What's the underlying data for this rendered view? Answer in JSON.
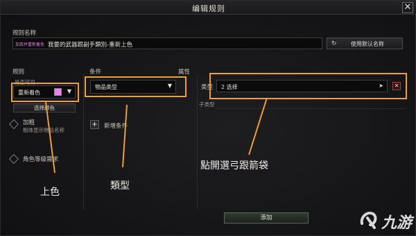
{
  "dialog": {
    "title": "编辑规则",
    "close_glyph": "✕"
  },
  "rule_name": {
    "label": "规则名称",
    "tag": "加我并重新着色",
    "value": "我要的武器跟副手類別-重新上色",
    "default_button_icon": "refresh-icon",
    "default_button_label": "使用默认名称"
  },
  "columns": {
    "rules_header": "规则",
    "conditions_header": "条件",
    "attributes_header": "属性"
  },
  "rules_panel": {
    "visible_label": "是否可见",
    "recolor_value": "重新着色",
    "swatch_color": "#f07ef0",
    "select_color_button": "选择颜色",
    "option1_label": "加粗",
    "option1_desc": "粗体显示物品名称",
    "option2_label": "角色等级需求"
  },
  "conditions_panel": {
    "item_type_value": "物品类型",
    "add_condition_label": "新增条件"
  },
  "attributes_panel": {
    "type_label": "类型",
    "type_value": "2 选择",
    "subtype_label": "子类型"
  },
  "annotations": {
    "color": "上色",
    "type": "類型",
    "bow": "點開選弓跟箭袋"
  },
  "footer": {
    "add_button": "添加"
  },
  "watermark": {
    "text": "九游"
  },
  "colors": {
    "accent_orange": "#f0a030",
    "pink": "#f07ef0"
  }
}
